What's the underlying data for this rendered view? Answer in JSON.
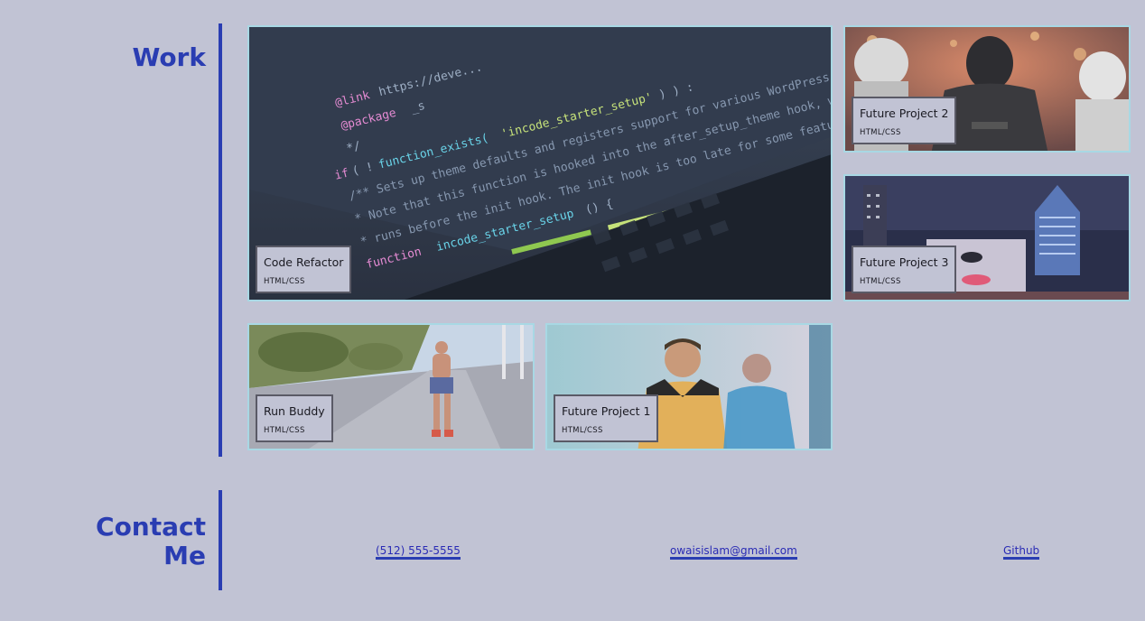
{
  "work": {
    "title": "Work",
    "projects": [
      {
        "name": "Code Refactor",
        "tech": "HTML/CSS"
      },
      {
        "name": "Future Project 2",
        "tech": "HTML/CSS"
      },
      {
        "name": "Future Project 3",
        "tech": "HTML/CSS"
      },
      {
        "name": "Run Buddy",
        "tech": "HTML/CSS"
      },
      {
        "name": "Future Project 1",
        "tech": "HTML/CSS"
      }
    ]
  },
  "contact": {
    "title_line1": "Contact",
    "title_line2": "Me",
    "phone": "(512) 555-5555",
    "email": "owaisislam@gmail.com",
    "github": "Github"
  },
  "colors": {
    "background": "#c1c3d4",
    "accent": "#2a3db2",
    "card_border": "#a8d8e4"
  }
}
